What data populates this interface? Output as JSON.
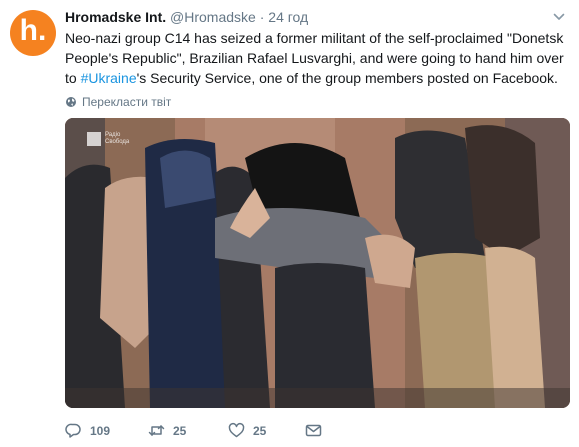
{
  "tweet": {
    "avatar_letter": "h.",
    "avatar_color": "#f58220",
    "author_name": "Hromadske Int.",
    "author_handle": "@Hromadske",
    "separator": "·",
    "timestamp": "24 год",
    "text_part1": "Neo-nazi group C14 has seized a former militant of the self-proclaimed \"Donetsk People's Republic\", Brazilian Rafael Lusvarghi, and were going to hand him over to ",
    "hashtag": "#Ukraine",
    "text_part2": "'s Security Service, one of the group members posted on Facebook.",
    "translate_label": "Перекласти твіт",
    "media_watermark": "Радіо Свобода",
    "actions": {
      "reply_count": "109",
      "retweet_count": "25",
      "like_count": "25"
    },
    "icons": {
      "caret": "chevron-down-icon",
      "globe": "globe-icon",
      "reply": "reply-icon",
      "retweet": "retweet-icon",
      "like": "heart-icon",
      "dm": "envelope-icon"
    },
    "colors": {
      "link": "#1b95e0",
      "secondary": "#657786",
      "primary_text": "#14171a"
    }
  }
}
